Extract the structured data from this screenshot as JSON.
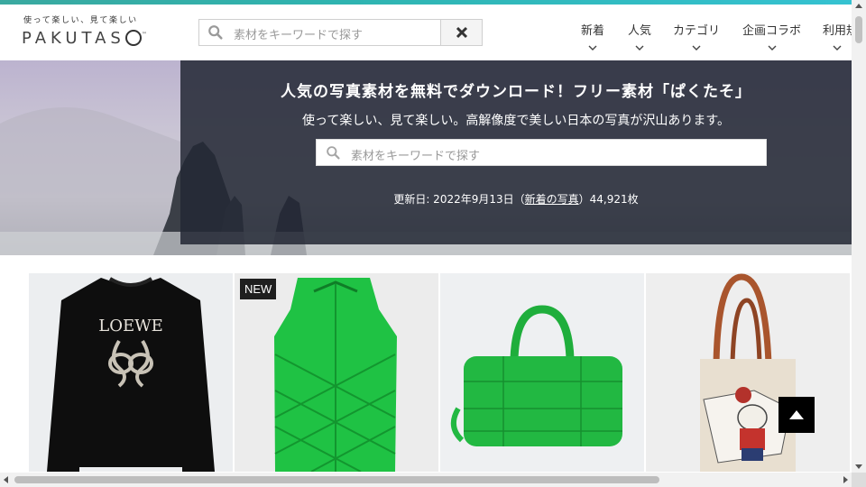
{
  "header": {
    "logo_tagline": "使って楽しい、見て楽しい",
    "logo_text": "PAKUTAS",
    "logo_tm": "™",
    "search_placeholder": "素材をキーワードで探す",
    "nav": [
      {
        "label": "新着"
      },
      {
        "label": "人気"
      },
      {
        "label": "カテゴリ"
      },
      {
        "label": "企画コラボ"
      },
      {
        "label": "利用規"
      }
    ]
  },
  "hero": {
    "title": "人気の写真素材を無料でダウンロード！フリー素材「ぱくたそ」",
    "subtitle": "使って楽しい、見て楽しい。高解像度で美しい日本の写真が沢山あります。",
    "search_placeholder": "素材をキーワードで探す",
    "update_prefix": "更新日: 2022年9月13日（",
    "update_link": "新着の写真",
    "update_suffix": "）44,921枚"
  },
  "products": {
    "items": [
      {
        "icon": "black-sweatshirt-image",
        "print_text": "LOEWE",
        "badge": ""
      },
      {
        "icon": "green-puffer-vest-image",
        "badge": "NEW"
      },
      {
        "icon": "green-woven-bag-image",
        "badge": ""
      },
      {
        "icon": "embroidered-tote-bag-image",
        "badge": ""
      }
    ]
  },
  "colors": {
    "accent_gradient_start": "#3aa9a0",
    "accent_gradient_end": "#35c2d1",
    "hero_panel": "#232834",
    "product_green": "#1fc244"
  }
}
